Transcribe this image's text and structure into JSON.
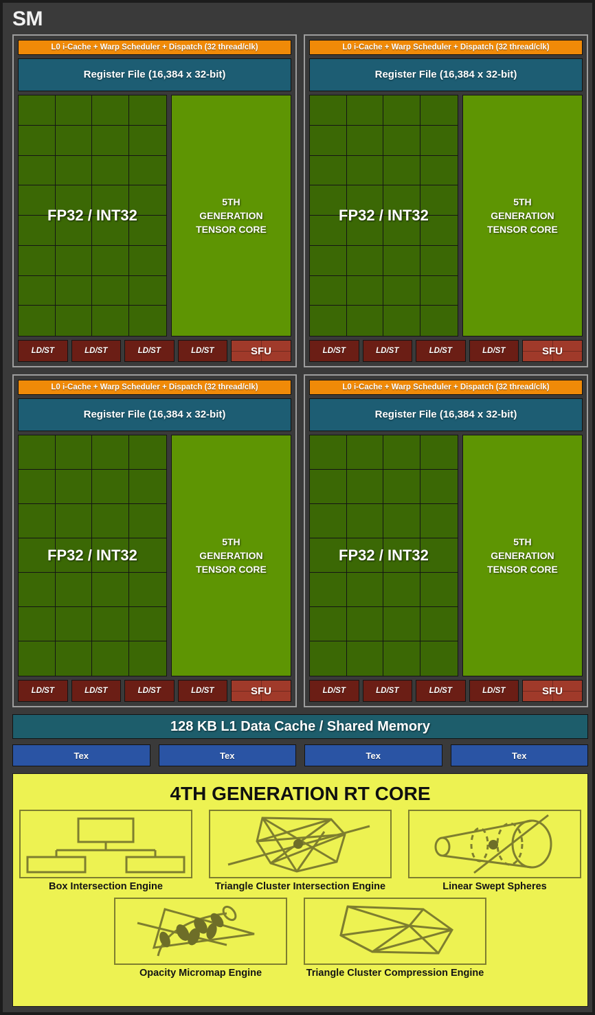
{
  "title": "SM",
  "colors": {
    "background": "#3a3a3a",
    "scheduler_orange": "#f08a08",
    "register_teal": "#1d5d73",
    "fp32_green": "#3b6805",
    "tensor_green": "#5e9503",
    "ldst_red": "#6b1e15",
    "sfu_red": "#a03a2a",
    "l1_teal": "#1d5d6b",
    "tex_blue": "#2a54a4",
    "rt_yellow": "#edf252",
    "rt_stroke": "#7e7e2f"
  },
  "processing_blocks": [
    {
      "scheduler": "L0 i-Cache + Warp Scheduler + Dispatch (32 thread/clk)",
      "register_file": "Register File (16,384 x 32-bit)",
      "fp_label": "FP32 / INT32",
      "fp_grid": {
        "columns": 4,
        "rows": 8
      },
      "tensor_core": "5TH GENERATION TENSOR CORE",
      "tensor_core_lines": [
        "5TH",
        "GENERATION",
        "TENSOR CORE"
      ],
      "ldst": [
        "LD/ST",
        "LD/ST",
        "LD/ST",
        "LD/ST"
      ],
      "sfu": "SFU"
    },
    {
      "scheduler": "L0 i-Cache + Warp Scheduler + Dispatch (32 thread/clk)",
      "register_file": "Register File (16,384 x 32-bit)",
      "fp_label": "FP32 / INT32",
      "fp_grid": {
        "columns": 4,
        "rows": 8
      },
      "tensor_core": "5TH GENERATION TENSOR CORE",
      "tensor_core_lines": [
        "5TH",
        "GENERATION",
        "TENSOR CORE"
      ],
      "ldst": [
        "LD/ST",
        "LD/ST",
        "LD/ST",
        "LD/ST"
      ],
      "sfu": "SFU"
    },
    {
      "scheduler": "L0 i-Cache + Warp Scheduler + Dispatch (32 thread/clk)",
      "register_file": "Register File (16,384 x 32-bit)",
      "fp_label": "FP32 / INT32",
      "fp_grid": {
        "columns": 4,
        "rows": 7
      },
      "tensor_core": "5TH GENERATION TENSOR CORE",
      "tensor_core_lines": [
        "5TH",
        "GENERATION",
        "TENSOR CORE"
      ],
      "ldst": [
        "LD/ST",
        "LD/ST",
        "LD/ST",
        "LD/ST"
      ],
      "sfu": "SFU"
    },
    {
      "scheduler": "L0 i-Cache + Warp Scheduler + Dispatch (32 thread/clk)",
      "register_file": "Register File (16,384 x 32-bit)",
      "fp_label": "FP32 / INT32",
      "fp_grid": {
        "columns": 4,
        "rows": 7
      },
      "tensor_core": "5TH GENERATION TENSOR CORE",
      "tensor_core_lines": [
        "5TH",
        "GENERATION",
        "TENSOR CORE"
      ],
      "ldst": [
        "LD/ST",
        "LD/ST",
        "LD/ST",
        "LD/ST"
      ],
      "sfu": "SFU"
    }
  ],
  "l1_cache": "128 KB L1 Data Cache / Shared Memory",
  "tex_units": [
    "Tex",
    "Tex",
    "Tex",
    "Tex"
  ],
  "rt_core": {
    "title": "4TH GENERATION RT CORE",
    "engines_row1": [
      {
        "label": "Box Intersection Engine",
        "icon": "box-hierarchy-icon"
      },
      {
        "label": "Triangle Cluster Intersection Engine",
        "icon": "triangle-mesh-ray-icon"
      },
      {
        "label": "Linear Swept Spheres",
        "icon": "swept-sphere-cone-icon"
      }
    ],
    "engines_row2": [
      {
        "label": "Opacity Micromap Engine",
        "icon": "foliage-alpha-icon"
      },
      {
        "label": "Triangle Cluster Compression Engine",
        "icon": "triangle-cluster-icon"
      }
    ]
  }
}
